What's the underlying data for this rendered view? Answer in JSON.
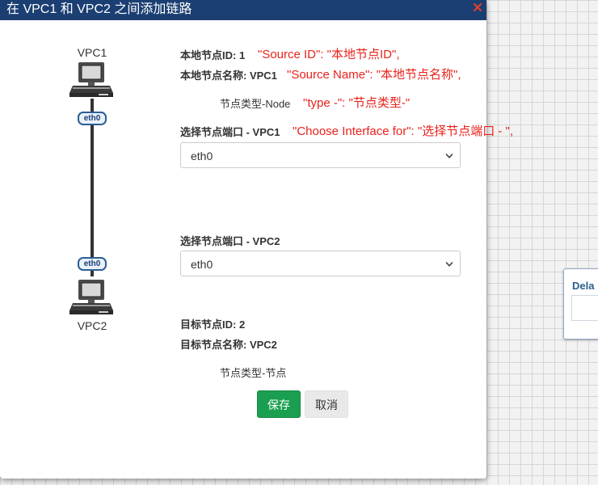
{
  "background": {
    "panel_label": "Dela"
  },
  "dialog": {
    "title": "在 VPC1 和 VPC2 之间添加链路",
    "close_icon": "close-x-icon",
    "accent_color": "#1b3f73"
  },
  "diagram": {
    "source_label": "VPC1",
    "target_label": "VPC2",
    "source_iface_badge": "eth0",
    "target_iface_badge": "eth0",
    "node_icon": "desktop-computer-icon"
  },
  "source": {
    "id_text": "本地节点ID: 1",
    "name_text": "本地节点名称: VPC1",
    "type_text": "节点类型-Node",
    "choose_label": "选择节点端口 - VPC1",
    "selected_interface": "eth0"
  },
  "target": {
    "choose_label": "选择节点端口 - VPC2",
    "selected_interface": "eth0",
    "id_text": "目标节点ID: 2",
    "name_text": "目标节点名称: VPC2",
    "type_text": "节点类型-节点"
  },
  "annotations": {
    "source_id": "\"Source ID\": \"本地节点ID\",",
    "source_name": "\"Source Name\": \"本地节点名称\",",
    "type": "\"type -\": \"节点类型-\"",
    "choose_interface": "\"Choose Interface for\": \"选择节点端口 - \",",
    "color": "#e8221b"
  },
  "buttons": {
    "save_label": "保存",
    "cancel_label": "取消",
    "save_color": "#1a9f50"
  }
}
